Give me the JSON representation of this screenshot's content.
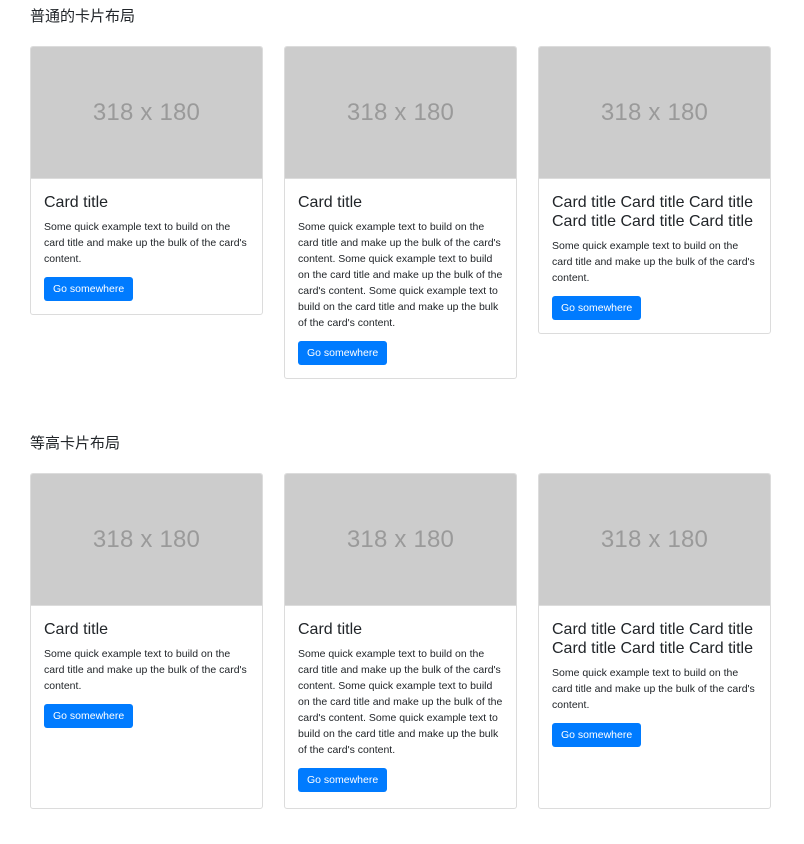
{
  "sections": [
    {
      "title": "普通的卡片布局",
      "cards": [
        {
          "image_label": "318 x 180",
          "title": "Card title",
          "text": "Some quick example text to build on the card title and make up the bulk of the card's content.",
          "button_label": "Go somewhere"
        },
        {
          "image_label": "318 x 180",
          "title": "Card title",
          "text": "Some quick example text to build on the card title and make up the bulk of the card's content. Some quick example text to build on the card title and make up the bulk of the card's content. Some quick example text to build on the card title and make up the bulk of the card's content.",
          "button_label": "Go somewhere"
        },
        {
          "image_label": "318 x 180",
          "title": "Card title Card title Card title Card title Card title Card title",
          "text": "Some quick example text to build on the card title and make up the bulk of the card's content.",
          "button_label": "Go somewhere"
        }
      ]
    },
    {
      "title": "等高卡片布局",
      "cards": [
        {
          "image_label": "318 x 180",
          "title": "Card title",
          "text": "Some quick example text to build on the card title and make up the bulk of the card's content.",
          "button_label": "Go somewhere"
        },
        {
          "image_label": "318 x 180",
          "title": "Card title",
          "text": "Some quick example text to build on the card title and make up the bulk of the card's content. Some quick example text to build on the card title and make up the bulk of the card's content. Some quick example text to build on the card title and make up the bulk of the card's content.",
          "button_label": "Go somewhere"
        },
        {
          "image_label": "318 x 180",
          "title": "Card title Card title Card title Card title Card title Card title",
          "text": "Some quick example text to build on the card title and make up the bulk of the card's content.",
          "button_label": "Go somewhere"
        }
      ]
    }
  ],
  "colors": {
    "button_bg": "#007bff",
    "image_placeholder_bg": "#cccccc",
    "image_placeholder_text": "#9a9a9a",
    "card_border": "#dcdcdc"
  }
}
